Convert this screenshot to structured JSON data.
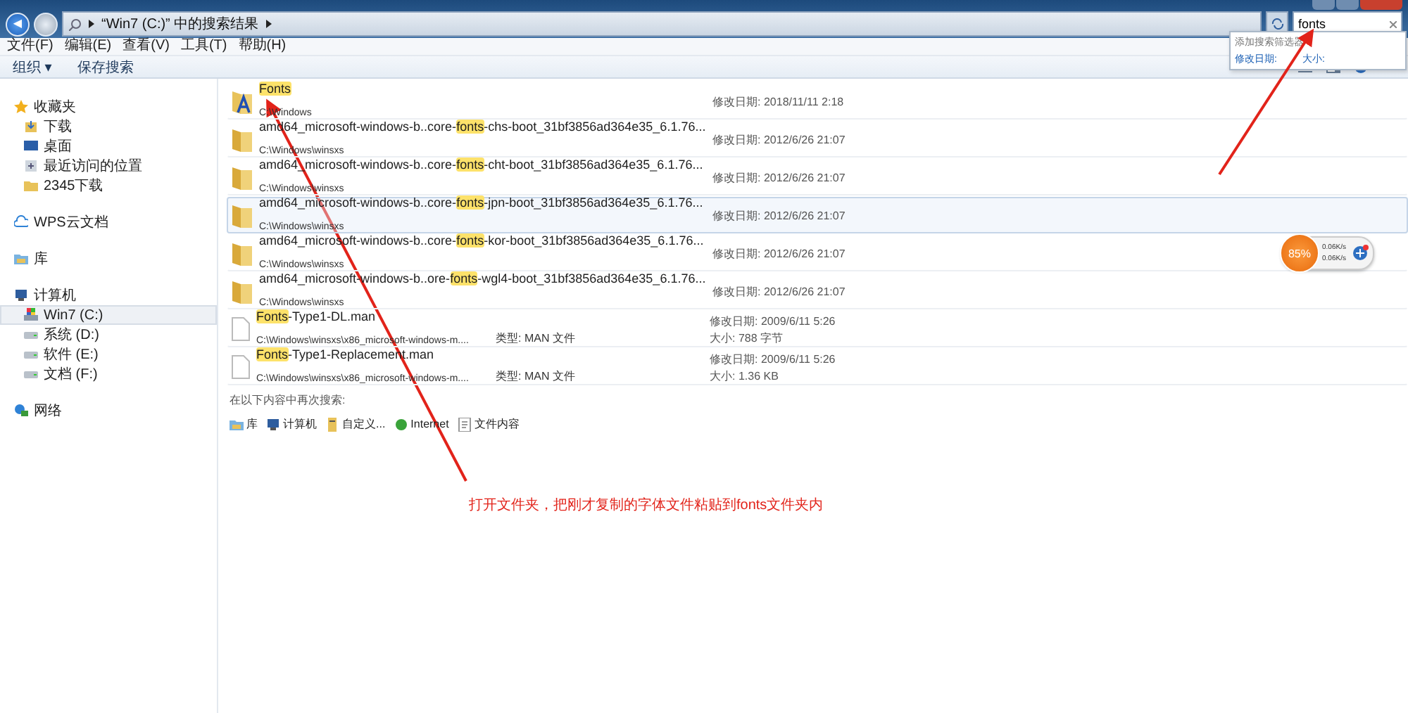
{
  "address": {
    "back": "◀",
    "path": "“Win7 (C:)” 中的搜索结果"
  },
  "search": {
    "value": "fonts"
  },
  "search_dropdown": {
    "title": "添加搜索筛选器",
    "filters": [
      "修改日期:",
      "大小:"
    ]
  },
  "menu": [
    "文件(F)",
    "编辑(E)",
    "查看(V)",
    "工具(T)",
    "帮助(H)"
  ],
  "toolbar": {
    "organize": "组织 ▾",
    "save_search": "保存搜索"
  },
  "sidebar": [
    {
      "label": "收藏夹",
      "children": [
        {
          "label": "下载",
          "selected": false
        },
        {
          "label": "桌面",
          "selected": false
        },
        {
          "label": "最近访问的位置",
          "selected": false
        },
        {
          "label": "2345下载",
          "selected": false
        }
      ]
    },
    {
      "label": "WPS云文档"
    },
    {
      "label": "库"
    },
    {
      "label": "计算机",
      "children": [
        {
          "label": "Win7 (C:)",
          "selected": true
        },
        {
          "label": "系统 (D:)",
          "selected": false
        },
        {
          "label": "软件 (E:)",
          "selected": false
        },
        {
          "label": "文档 (F:)",
          "selected": false
        }
      ]
    },
    {
      "label": "网络"
    }
  ],
  "results": [
    {
      "kind": "fontfolder",
      "match": "Fonts",
      "path": "C:\\Windows",
      "date_label": "修改日期:",
      "date": "2018/11/11 2:18",
      "selected": false
    },
    {
      "kind": "folder",
      "before": "amd64_microsoft-windows-b..core-",
      "match": "fonts",
      "after": "-chs-boot_31bf3856ad364e35_6.1.76...",
      "path": "C:\\Windows\\winsxs",
      "date_label": "修改日期:",
      "date": "2012/6/26 21:07",
      "selected": false
    },
    {
      "kind": "folder",
      "before": "amd64_microsoft-windows-b..core-",
      "match": "fonts",
      "after": "-cht-boot_31bf3856ad364e35_6.1.76...",
      "path": "C:\\Windows\\winsxs",
      "date_label": "修改日期:",
      "date": "2012/6/26 21:07",
      "selected": false
    },
    {
      "kind": "folder",
      "before": "amd64_microsoft-windows-b..core-",
      "match": "fonts",
      "after": "-jpn-boot_31bf3856ad364e35_6.1.76...",
      "path": "C:\\Windows\\winsxs",
      "date_label": "修改日期:",
      "date": "2012/6/26 21:07",
      "selected": true
    },
    {
      "kind": "folder",
      "before": "amd64_microsoft-windows-b..core-",
      "match": "fonts",
      "after": "-kor-boot_31bf3856ad364e35_6.1.76...",
      "path": "C:\\Windows\\winsxs",
      "date_label": "修改日期:",
      "date": "2012/6/26 21:07",
      "selected": false
    },
    {
      "kind": "folder",
      "before": "amd64_microsoft-windows-b..ore-",
      "match": "fonts",
      "after": "-wgl4-boot_31bf3856ad364e35_6.1.76...",
      "path": "C:\\Windows\\winsxs",
      "date_label": "修改日期:",
      "date": "2012/6/26 21:07",
      "selected": false
    },
    {
      "kind": "file",
      "match": "Fonts",
      "after": "-Type1-DL.man",
      "path": "C:\\Windows\\winsxs\\x86_microsoft-windows-m....",
      "type_label": "类型:",
      "type": "MAN 文件",
      "date_label": "修改日期:",
      "date": "2009/6/11 5:26",
      "size_label": "大小:",
      "size": "788 字节",
      "selected": false
    },
    {
      "kind": "file",
      "match": "Fonts",
      "after": "-Type1-Replacement.man",
      "path": "C:\\Windows\\winsxs\\x86_microsoft-windows-m....",
      "type_label": "类型:",
      "type": "MAN 文件",
      "date_label": "修改日期:",
      "date": "2009/6/11 5:26",
      "size_label": "大小:",
      "size": "1.36 KB",
      "selected": false
    }
  ],
  "search_again": {
    "title": "在以下内容中再次搜索:",
    "places": [
      "库",
      "计算机",
      "自定义...",
      "Internet",
      "文件内容"
    ]
  },
  "annotation": {
    "text": "打开文件夹，把刚才复制的字体文件粘贴到fonts文件夹内"
  },
  "net_widget": {
    "percent": "85%",
    "up": "0.06K/s",
    "down": "0.06K/s"
  }
}
